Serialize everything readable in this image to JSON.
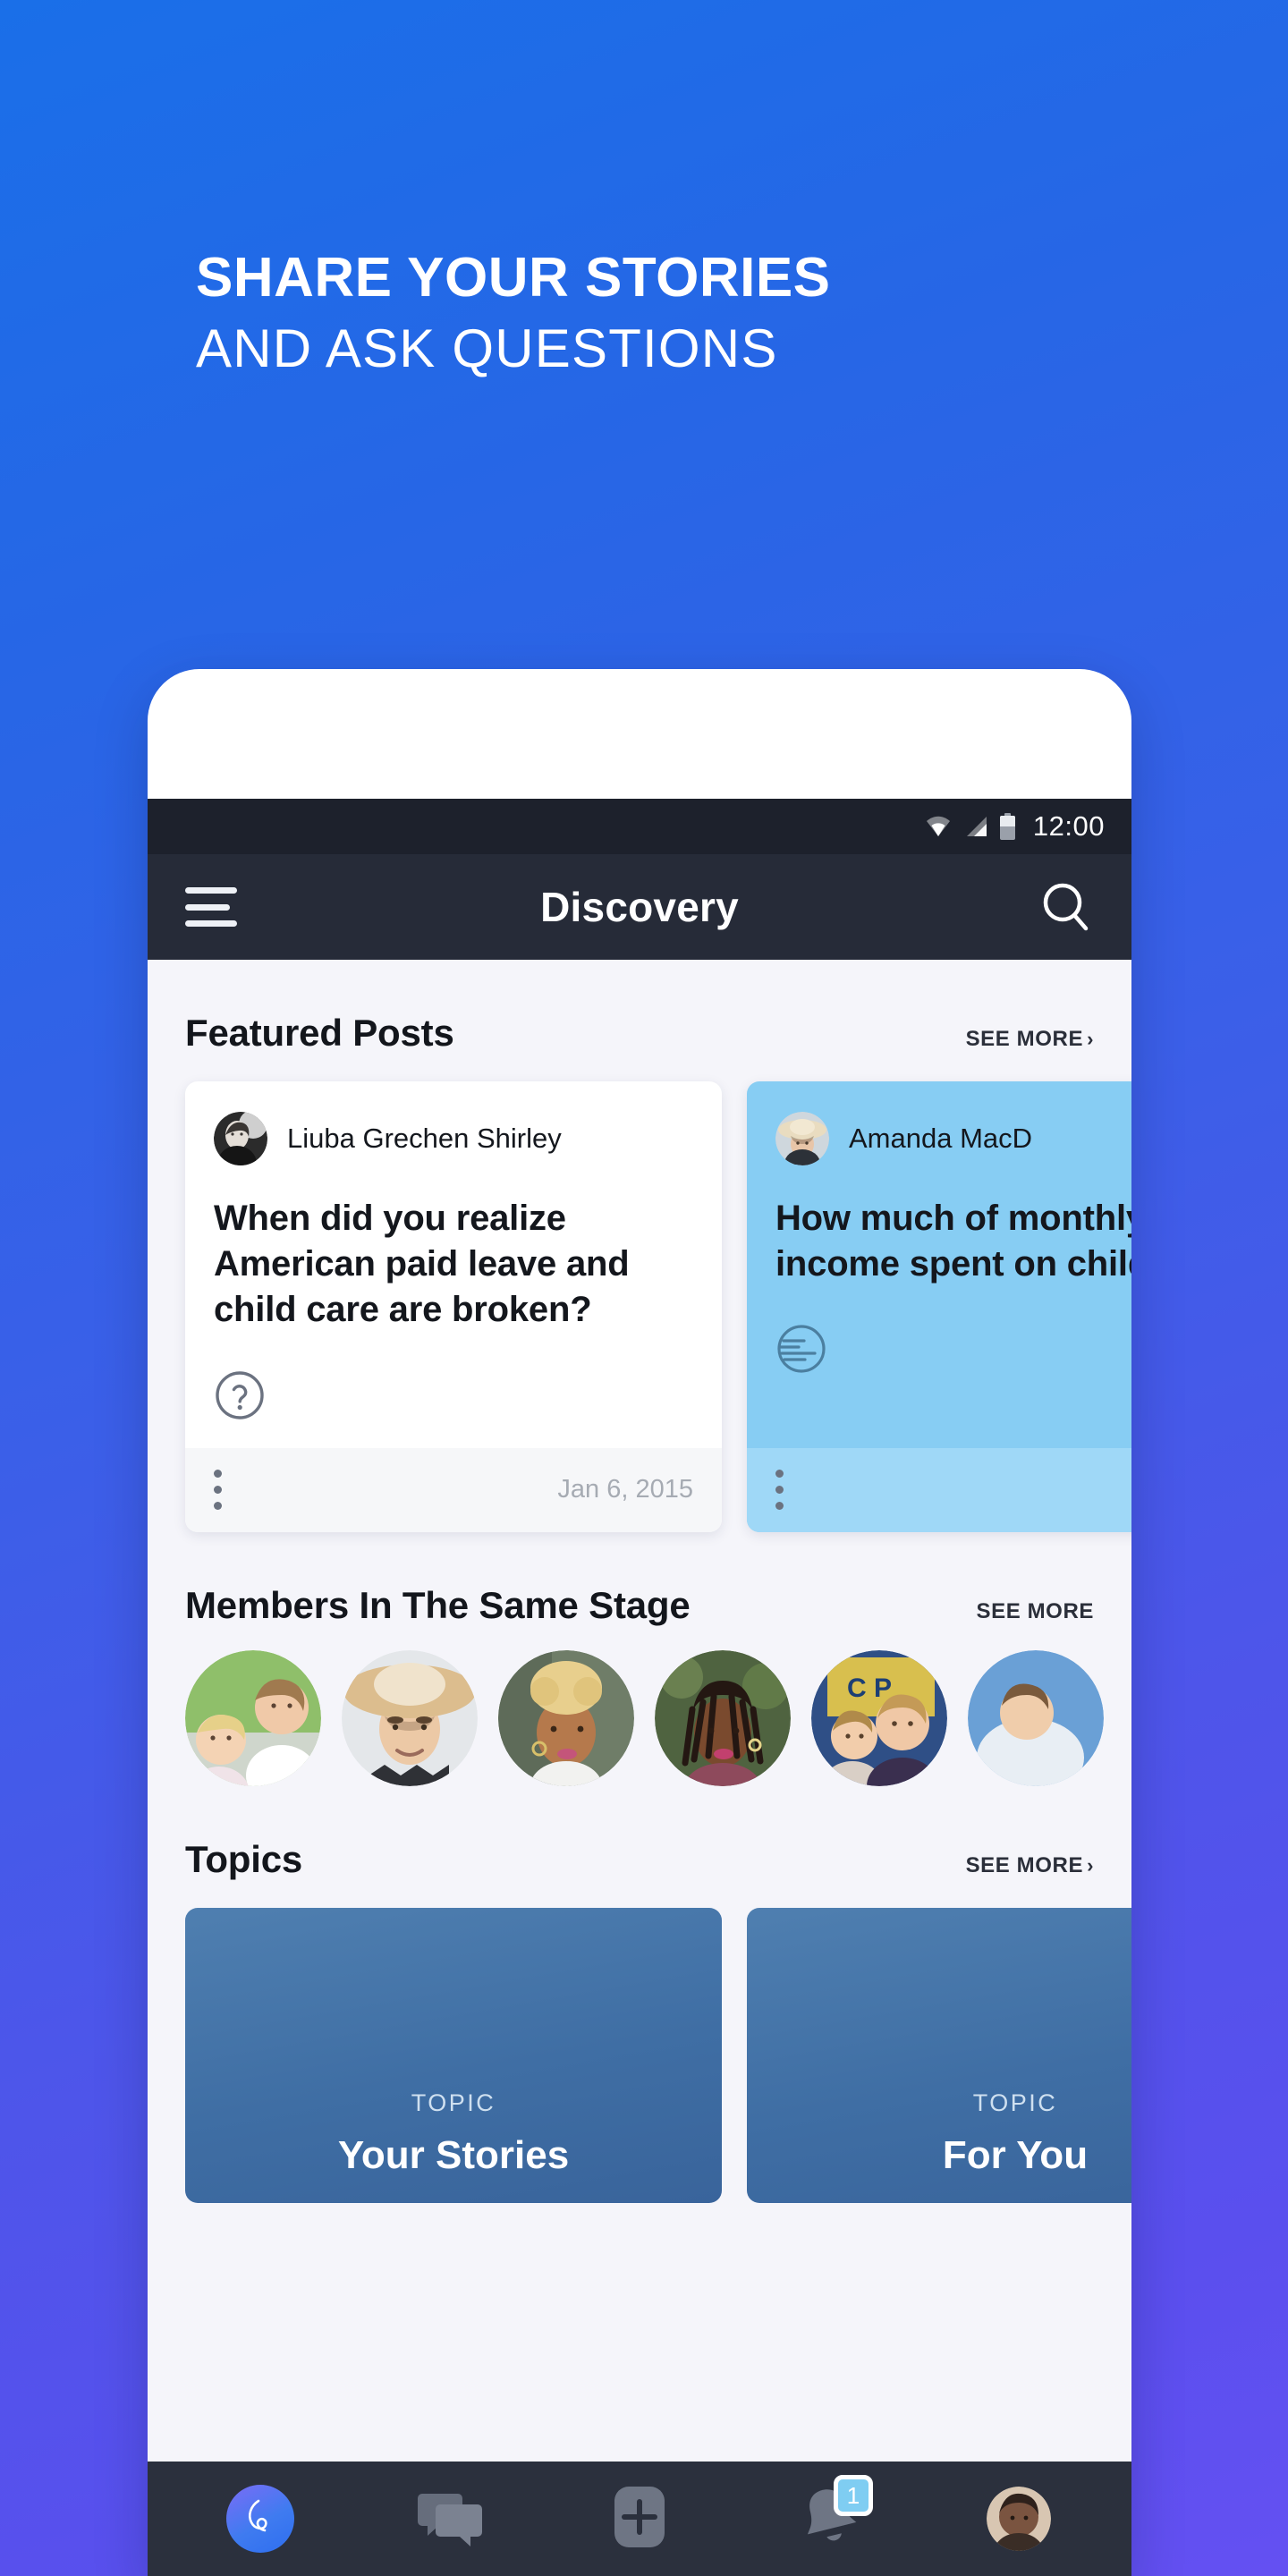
{
  "promo": {
    "line1": "SHARE YOUR STORIES",
    "line2": "AND ASK QUESTIONS"
  },
  "colors": {
    "bg_start": "#1a6fe8",
    "bg_end": "#6450f2",
    "appbar": "#262b38",
    "statusbar": "#1d212c",
    "screen_bg": "#f5f5fa",
    "card_blue": "#87cdf3",
    "topic_card": "#3f6ea4",
    "badge": "#7fcdf2"
  },
  "statusbar": {
    "time": "12:00",
    "icons": [
      "wifi-icon",
      "cellular-signal-icon",
      "battery-icon"
    ]
  },
  "appbar": {
    "menu_icon": "hamburger-menu-icon",
    "title": "Discovery",
    "search_icon": "search-icon"
  },
  "sections": {
    "featured": {
      "title": "Featured Posts",
      "see_more": "SEE MORE",
      "see_more_chevron": "›"
    },
    "members": {
      "title": "Members In The Same Stage",
      "see_more": "SEE MORE"
    },
    "topics": {
      "title": "Topics",
      "see_more": "SEE MORE",
      "see_more_chevron": "›"
    }
  },
  "featured_posts": [
    {
      "author": "Liuba Grechen Shirley",
      "question": "When did you realize American paid leave and child care are broken?",
      "type_icon": "question-circle-icon",
      "date": "Jan 6, 2015",
      "menu_icon": "kebab-menu-icon",
      "theme": "white"
    },
    {
      "author": "Amanda MacD",
      "question": "How much of monthly income spent on child",
      "type_icon": "poll-circle-icon",
      "date": "",
      "menu_icon": "kebab-menu-icon",
      "theme": "blue"
    }
  ],
  "members": [
    {
      "name": "member-1"
    },
    {
      "name": "member-2"
    },
    {
      "name": "member-3"
    },
    {
      "name": "member-4"
    },
    {
      "name": "member-5"
    },
    {
      "name": "member-6"
    }
  ],
  "topics": [
    {
      "kicker": "TOPIC",
      "name": "Your Stories"
    },
    {
      "kicker": "TOPIC",
      "name": "For You"
    }
  ],
  "bottom_nav": [
    {
      "icon": "app-logo-icon",
      "label": "",
      "badge": ""
    },
    {
      "icon": "chat-bubbles-icon",
      "label": "",
      "badge": ""
    },
    {
      "icon": "plus-square-icon",
      "label": "",
      "badge": ""
    },
    {
      "icon": "bell-icon",
      "label": "",
      "badge": "1"
    },
    {
      "icon": "profile-avatar-icon",
      "label": "",
      "badge": ""
    }
  ]
}
